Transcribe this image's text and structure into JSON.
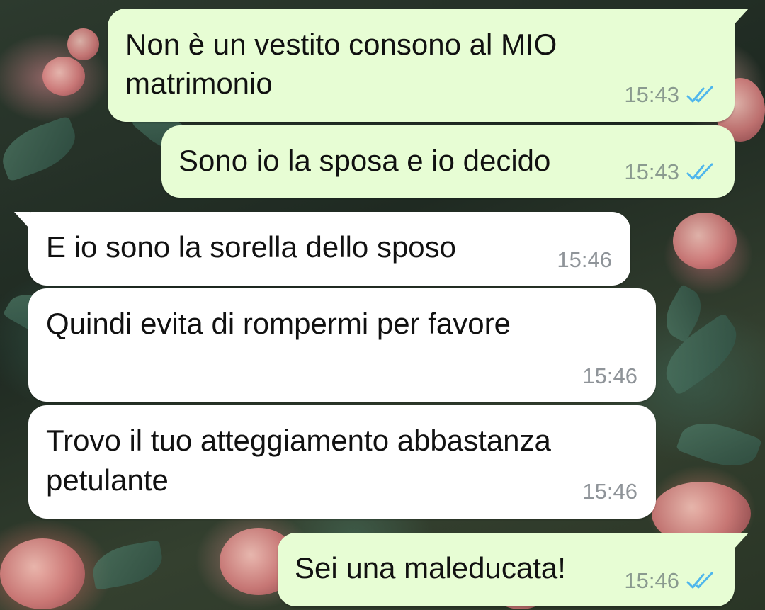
{
  "messages": [
    {
      "direction": "outgoing",
      "lines": [
        "Non è un vestito consono al MIO",
        "matrimonio"
      ],
      "time": "15:43",
      "status_icon": "double-check-read-icon"
    },
    {
      "direction": "outgoing",
      "lines": [
        "Sono io la sposa e io decido"
      ],
      "time": "15:43",
      "status_icon": "double-check-read-icon"
    },
    {
      "direction": "incoming",
      "lines": [
        "E io sono la sorella dello sposo"
      ],
      "time": "15:46"
    },
    {
      "direction": "incoming",
      "lines": [
        "Quindi evita di rompermi per favore"
      ],
      "time": "15:46"
    },
    {
      "direction": "incoming",
      "lines": [
        "Trovo il tuo atteggiamento abbastanza",
        "petulante"
      ],
      "time": "15:46"
    },
    {
      "direction": "outgoing",
      "lines": [
        "Sei una maleducata!"
      ],
      "time": "15:46",
      "status_icon": "double-check-read-icon"
    }
  ],
  "colors": {
    "outgoing_bubble": "#e7fdd4",
    "incoming_bubble": "#ffffff",
    "read_ticks": "#4fb6ec",
    "timestamp": "#8a9a8f"
  },
  "wallpaper": "floral-roses-wallpaper"
}
